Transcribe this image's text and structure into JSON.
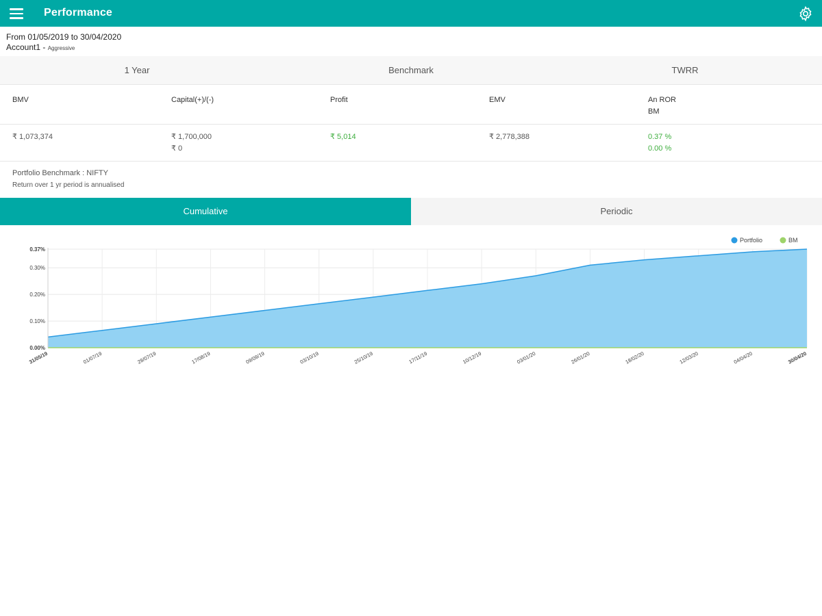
{
  "header": {
    "title": "Performance",
    "menu_icon": "menu-icon",
    "settings_icon": "gear-icon"
  },
  "summary": {
    "range": "From 01/05/2019 to 30/04/2020",
    "account_name": "Account1 -",
    "account_profile": "Aggressive"
  },
  "period_selector": [
    "1 Year",
    "Benchmark",
    "TWRR"
  ],
  "metrics": {
    "headers": [
      [
        "BMV"
      ],
      [
        "Capital(+)/(-)"
      ],
      [
        "Profit"
      ],
      [
        "EMV"
      ],
      [
        "An ROR",
        "BM"
      ]
    ],
    "values": [
      [
        "₹ 1,073,374"
      ],
      [
        "₹ 1,700,000",
        "₹ 0"
      ],
      [
        "₹ 5,014"
      ],
      [
        "₹ 2,778,388"
      ],
      [
        "0.37 %",
        "0.00 %"
      ]
    ]
  },
  "notes": {
    "benchmark": "Portfolio Benchmark : NIFTY",
    "annualised": "Return over 1 yr period is annualised"
  },
  "tabs": {
    "cumulative": "Cumulative",
    "periodic": "Periodic"
  },
  "colors": {
    "accent": "#00a9a5",
    "portfolio": "#2b9be2",
    "portfolio_fill": "#93d2f3",
    "bm": "#9ed36a",
    "profit_green": "#3fae3f"
  },
  "chart_data": {
    "type": "area",
    "x": [
      "31/05/19",
      "01/07/19",
      "28/07/19",
      "17/08/19",
      "09/09/19",
      "03/10/19",
      "25/10/19",
      "17/11/19",
      "10/12/19",
      "03/01/20",
      "26/01/20",
      "18/02/20",
      "12/03/20",
      "04/04/20",
      "30/04/20"
    ],
    "series": [
      {
        "name": "Portfolio",
        "values": [
          0.04,
          0.065,
          0.09,
          0.115,
          0.14,
          0.165,
          0.19,
          0.215,
          0.24,
          0.27,
          0.31,
          0.33,
          0.345,
          0.36,
          0.37
        ]
      },
      {
        "name": "BM",
        "values": [
          0,
          0,
          0,
          0,
          0,
          0,
          0,
          0,
          0,
          0,
          0,
          0,
          0,
          0,
          0
        ]
      }
    ],
    "y_ticks": [
      "0.00%",
      "0.10%",
      "0.20%",
      "0.30%",
      "0.37%"
    ],
    "ylim": [
      0,
      0.37
    ],
    "legend": "top-right",
    "grid": true
  }
}
